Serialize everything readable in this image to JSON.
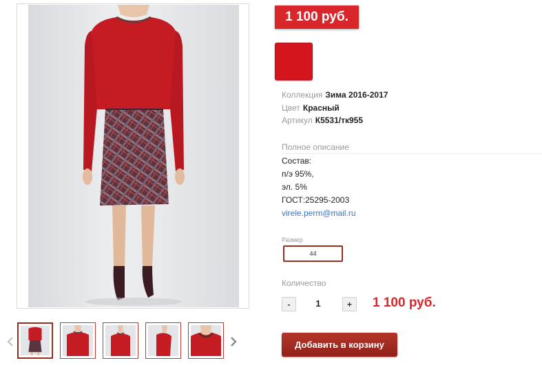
{
  "product": {
    "price_badge": "1 100 руб.",
    "color_swatch": "#d5151d",
    "specs": {
      "collection_label": "Коллекция",
      "collection_value": "Зима 2016-2017",
      "color_label": "Цвет",
      "color_value": "Красный",
      "article_label": "Артикул",
      "article_value": "К5531/тк955"
    },
    "description": {
      "title": "Полное описание",
      "lines": [
        "Состав:",
        "п/э 95%,",
        "эл. 5%",
        "ГОСТ:25295-2003"
      ],
      "email": "virele.perm@mail.ru"
    },
    "size": {
      "label": "Размер",
      "selected": "44"
    },
    "quantity": {
      "label": "Количество",
      "minus": "-",
      "plus": "+",
      "value": "1"
    },
    "total_price": "1 100 руб.",
    "add_to_cart": "Добавить в корзину"
  },
  "gallery": {
    "thumbnail_views": [
      "full-outfit",
      "top-front",
      "top-front-close",
      "top-side",
      "neckline-detail"
    ],
    "active_index": 0,
    "prev_icon": "chevron-left-icon",
    "next_icon": "chevron-right-icon"
  },
  "colors": {
    "accent": "#d9262a",
    "button": "#9b2a1f",
    "link": "#3b72b7"
  }
}
